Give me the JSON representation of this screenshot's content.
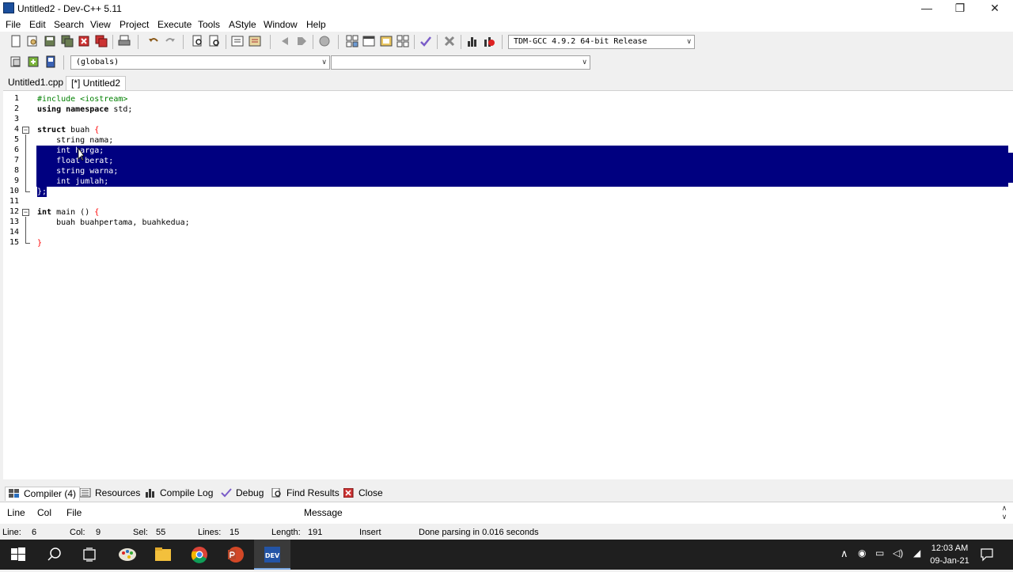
{
  "window": {
    "title": "Untitled2 - Dev-C++ 5.11"
  },
  "menu": [
    "File",
    "Edit",
    "Search",
    "View",
    "Project",
    "Execute",
    "Tools",
    "AStyle",
    "Window",
    "Help"
  ],
  "compiler_select": "TDM-GCC 4.9.2 64-bit Release",
  "scope_select": "(globals)",
  "member_select": "",
  "tabs": [
    "Untitled1.cpp",
    "[*] Untitled2"
  ],
  "code": {
    "l1": "#include <iostream>",
    "l2a": "using namespace",
    "l2b": " std;",
    "l4a": "struct",
    "l4b": " buah ",
    "l4c": "{",
    "l5": "    string nama;",
    "l6": "    int harga;",
    "l7": "    float berat;",
    "l8": "    string warna;",
    "l9": "    int jumlah;",
    "l10": "};",
    "l12a": "int",
    "l12b": " main () ",
    "l12c": "{",
    "l13": "    buah buahpertama, buahkedua;",
    "l15": "}"
  },
  "line_numbers": [
    "1",
    "2",
    "3",
    "4",
    "5",
    "6",
    "7",
    "8",
    "9",
    "10",
    "11",
    "12",
    "13",
    "14",
    "15"
  ],
  "bottom_tabs": [
    "Compiler (4)",
    "Resources",
    "Compile Log",
    "Debug",
    "Find Results",
    "Close"
  ],
  "msg_columns": [
    "Line",
    "Col",
    "File",
    "Message"
  ],
  "status": {
    "line_label": "Line:",
    "line": "6",
    "col_label": "Col:",
    "col": "9",
    "sel_label": "Sel:",
    "sel": "55",
    "lines_label": "Lines:",
    "lines": "15",
    "length_label": "Length:",
    "length": "191",
    "mode": "Insert",
    "message": "Done parsing in 0.016 seconds"
  },
  "clock": {
    "time": "12:03 AM",
    "date": "09-Jan-21"
  },
  "colors": {
    "selection": "#000080",
    "preprocessor": "#008000",
    "symbol": "#ff0000"
  }
}
